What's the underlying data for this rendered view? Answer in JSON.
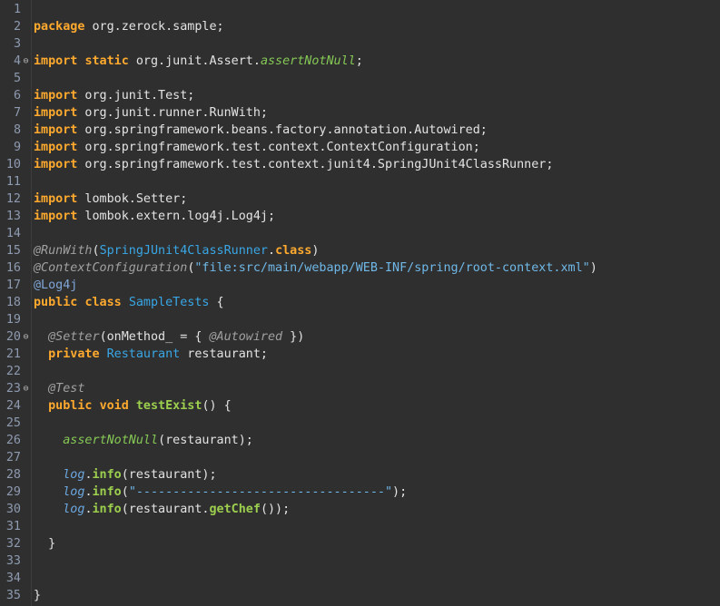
{
  "colors": {
    "background": "#2f2f2f",
    "line_number": "#8e9ab0",
    "keyword": "#ffaa2e",
    "plain": "#e3e3e3",
    "static_method": "#85c855",
    "type": "#39a7e6",
    "annotation": "#a0a0a0",
    "string": "#6fb8e8",
    "method": "#9ccf4d",
    "static_field": "#6ca8e0"
  },
  "lines": [
    {
      "n": "1",
      "fold": "",
      "tokens": []
    },
    {
      "n": "2",
      "fold": "",
      "tokens": [
        [
          "kw",
          "package"
        ],
        [
          "pl",
          " org.zerock.sample;"
        ]
      ]
    },
    {
      "n": "3",
      "fold": "",
      "tokens": []
    },
    {
      "n": "4",
      "fold": "collapse-icon",
      "tokens": [
        [
          "kw",
          "import"
        ],
        [
          "pl",
          " "
        ],
        [
          "kw",
          "static"
        ],
        [
          "pl",
          " org.junit.Assert."
        ],
        [
          "sm",
          "assertNotNull"
        ],
        [
          "pl",
          ";"
        ]
      ]
    },
    {
      "n": "5",
      "fold": "",
      "tokens": []
    },
    {
      "n": "6",
      "fold": "",
      "tokens": [
        [
          "kw",
          "import"
        ],
        [
          "pl",
          " org.junit.Test;"
        ]
      ]
    },
    {
      "n": "7",
      "fold": "",
      "tokens": [
        [
          "kw",
          "import"
        ],
        [
          "pl",
          " org.junit.runner.RunWith;"
        ]
      ]
    },
    {
      "n": "8",
      "fold": "",
      "tokens": [
        [
          "kw",
          "import"
        ],
        [
          "pl",
          " org.springframework.beans.factory.annotation.Autowired;"
        ]
      ]
    },
    {
      "n": "9",
      "fold": "",
      "tokens": [
        [
          "kw",
          "import"
        ],
        [
          "pl",
          " org.springframework.test.context.ContextConfiguration;"
        ]
      ]
    },
    {
      "n": "10",
      "fold": "",
      "tokens": [
        [
          "kw",
          "import"
        ],
        [
          "pl",
          " org.springframework.test.context.junit4.SpringJUnit4ClassRunner;"
        ]
      ]
    },
    {
      "n": "11",
      "fold": "",
      "tokens": []
    },
    {
      "n": "12",
      "fold": "",
      "tokens": [
        [
          "kw",
          "import"
        ],
        [
          "pl",
          " lombok.Setter;"
        ]
      ]
    },
    {
      "n": "13",
      "fold": "",
      "tokens": [
        [
          "kw",
          "import"
        ],
        [
          "pl",
          " lombok.extern.log4j.Log4j;"
        ]
      ]
    },
    {
      "n": "14",
      "fold": "",
      "tokens": []
    },
    {
      "n": "15",
      "fold": "",
      "tokens": [
        [
          "an",
          "@RunWith"
        ],
        [
          "pu",
          "("
        ],
        [
          "ty",
          "SpringJUnit4ClassRunner"
        ],
        [
          "pu",
          "."
        ],
        [
          "kw",
          "class"
        ],
        [
          "pu",
          ")"
        ]
      ]
    },
    {
      "n": "16",
      "fold": "",
      "tokens": [
        [
          "an",
          "@ContextConfiguration"
        ],
        [
          "pu",
          "("
        ],
        [
          "st",
          "\"file:src/main/webapp/WEB-INF/spring/root-context.xml\""
        ],
        [
          "pu",
          ")"
        ]
      ]
    },
    {
      "n": "17",
      "fold": "",
      "tokens": [
        [
          "an2",
          "@Log4j"
        ]
      ]
    },
    {
      "n": "18",
      "fold": "",
      "tokens": [
        [
          "kw",
          "public"
        ],
        [
          "pl",
          " "
        ],
        [
          "kw",
          "class"
        ],
        [
          "pl",
          " "
        ],
        [
          "ty",
          "SampleTests"
        ],
        [
          "pl",
          " {"
        ]
      ]
    },
    {
      "n": "19",
      "fold": "",
      "tokens": []
    },
    {
      "n": "20",
      "fold": "collapse-icon",
      "tokens": [
        [
          "pl",
          "  "
        ],
        [
          "an",
          "@Setter"
        ],
        [
          "pu",
          "(onMethod_ = { "
        ],
        [
          "an",
          "@Autowired"
        ],
        [
          "pu",
          " })"
        ]
      ]
    },
    {
      "n": "21",
      "fold": "",
      "tokens": [
        [
          "pl",
          "  "
        ],
        [
          "kw",
          "private"
        ],
        [
          "pl",
          " "
        ],
        [
          "ty",
          "Restaurant"
        ],
        [
          "pl",
          " restaurant;"
        ]
      ]
    },
    {
      "n": "22",
      "fold": "",
      "tokens": []
    },
    {
      "n": "23",
      "fold": "collapse-icon",
      "tokens": [
        [
          "pl",
          "  "
        ],
        [
          "an",
          "@Test"
        ]
      ]
    },
    {
      "n": "24",
      "fold": "",
      "tokens": [
        [
          "pl",
          "  "
        ],
        [
          "kw",
          "public"
        ],
        [
          "pl",
          " "
        ],
        [
          "kw",
          "void"
        ],
        [
          "pl",
          " "
        ],
        [
          "me",
          "testExist"
        ],
        [
          "pl",
          "() {"
        ]
      ]
    },
    {
      "n": "25",
      "fold": "",
      "tokens": []
    },
    {
      "n": "26",
      "fold": "",
      "tokens": [
        [
          "pl",
          "    "
        ],
        [
          "sm",
          "assertNotNull"
        ],
        [
          "pl",
          "(restaurant);"
        ]
      ]
    },
    {
      "n": "27",
      "fold": "",
      "tokens": []
    },
    {
      "n": "28",
      "fold": "",
      "tokens": [
        [
          "pl",
          "    "
        ],
        [
          "fi",
          "log"
        ],
        [
          "pl",
          "."
        ],
        [
          "me",
          "info"
        ],
        [
          "pl",
          "(restaurant);"
        ]
      ]
    },
    {
      "n": "29",
      "fold": "",
      "tokens": [
        [
          "pl",
          "    "
        ],
        [
          "fi",
          "log"
        ],
        [
          "pl",
          "."
        ],
        [
          "me",
          "info"
        ],
        [
          "pl",
          "("
        ],
        [
          "st",
          "\"----------------------------------\""
        ],
        [
          "pl",
          ");"
        ]
      ]
    },
    {
      "n": "30",
      "fold": "",
      "tokens": [
        [
          "pl",
          "    "
        ],
        [
          "fi",
          "log"
        ],
        [
          "pl",
          "."
        ],
        [
          "me",
          "info"
        ],
        [
          "pl",
          "(restaurant."
        ],
        [
          "me",
          "getChef"
        ],
        [
          "pl",
          "());"
        ]
      ]
    },
    {
      "n": "31",
      "fold": "",
      "tokens": []
    },
    {
      "n": "32",
      "fold": "",
      "tokens": [
        [
          "pl",
          "  }"
        ]
      ]
    },
    {
      "n": "33",
      "fold": "",
      "tokens": []
    },
    {
      "n": "34",
      "fold": "",
      "tokens": []
    },
    {
      "n": "35",
      "fold": "",
      "tokens": [
        [
          "pl",
          "}"
        ]
      ]
    }
  ]
}
